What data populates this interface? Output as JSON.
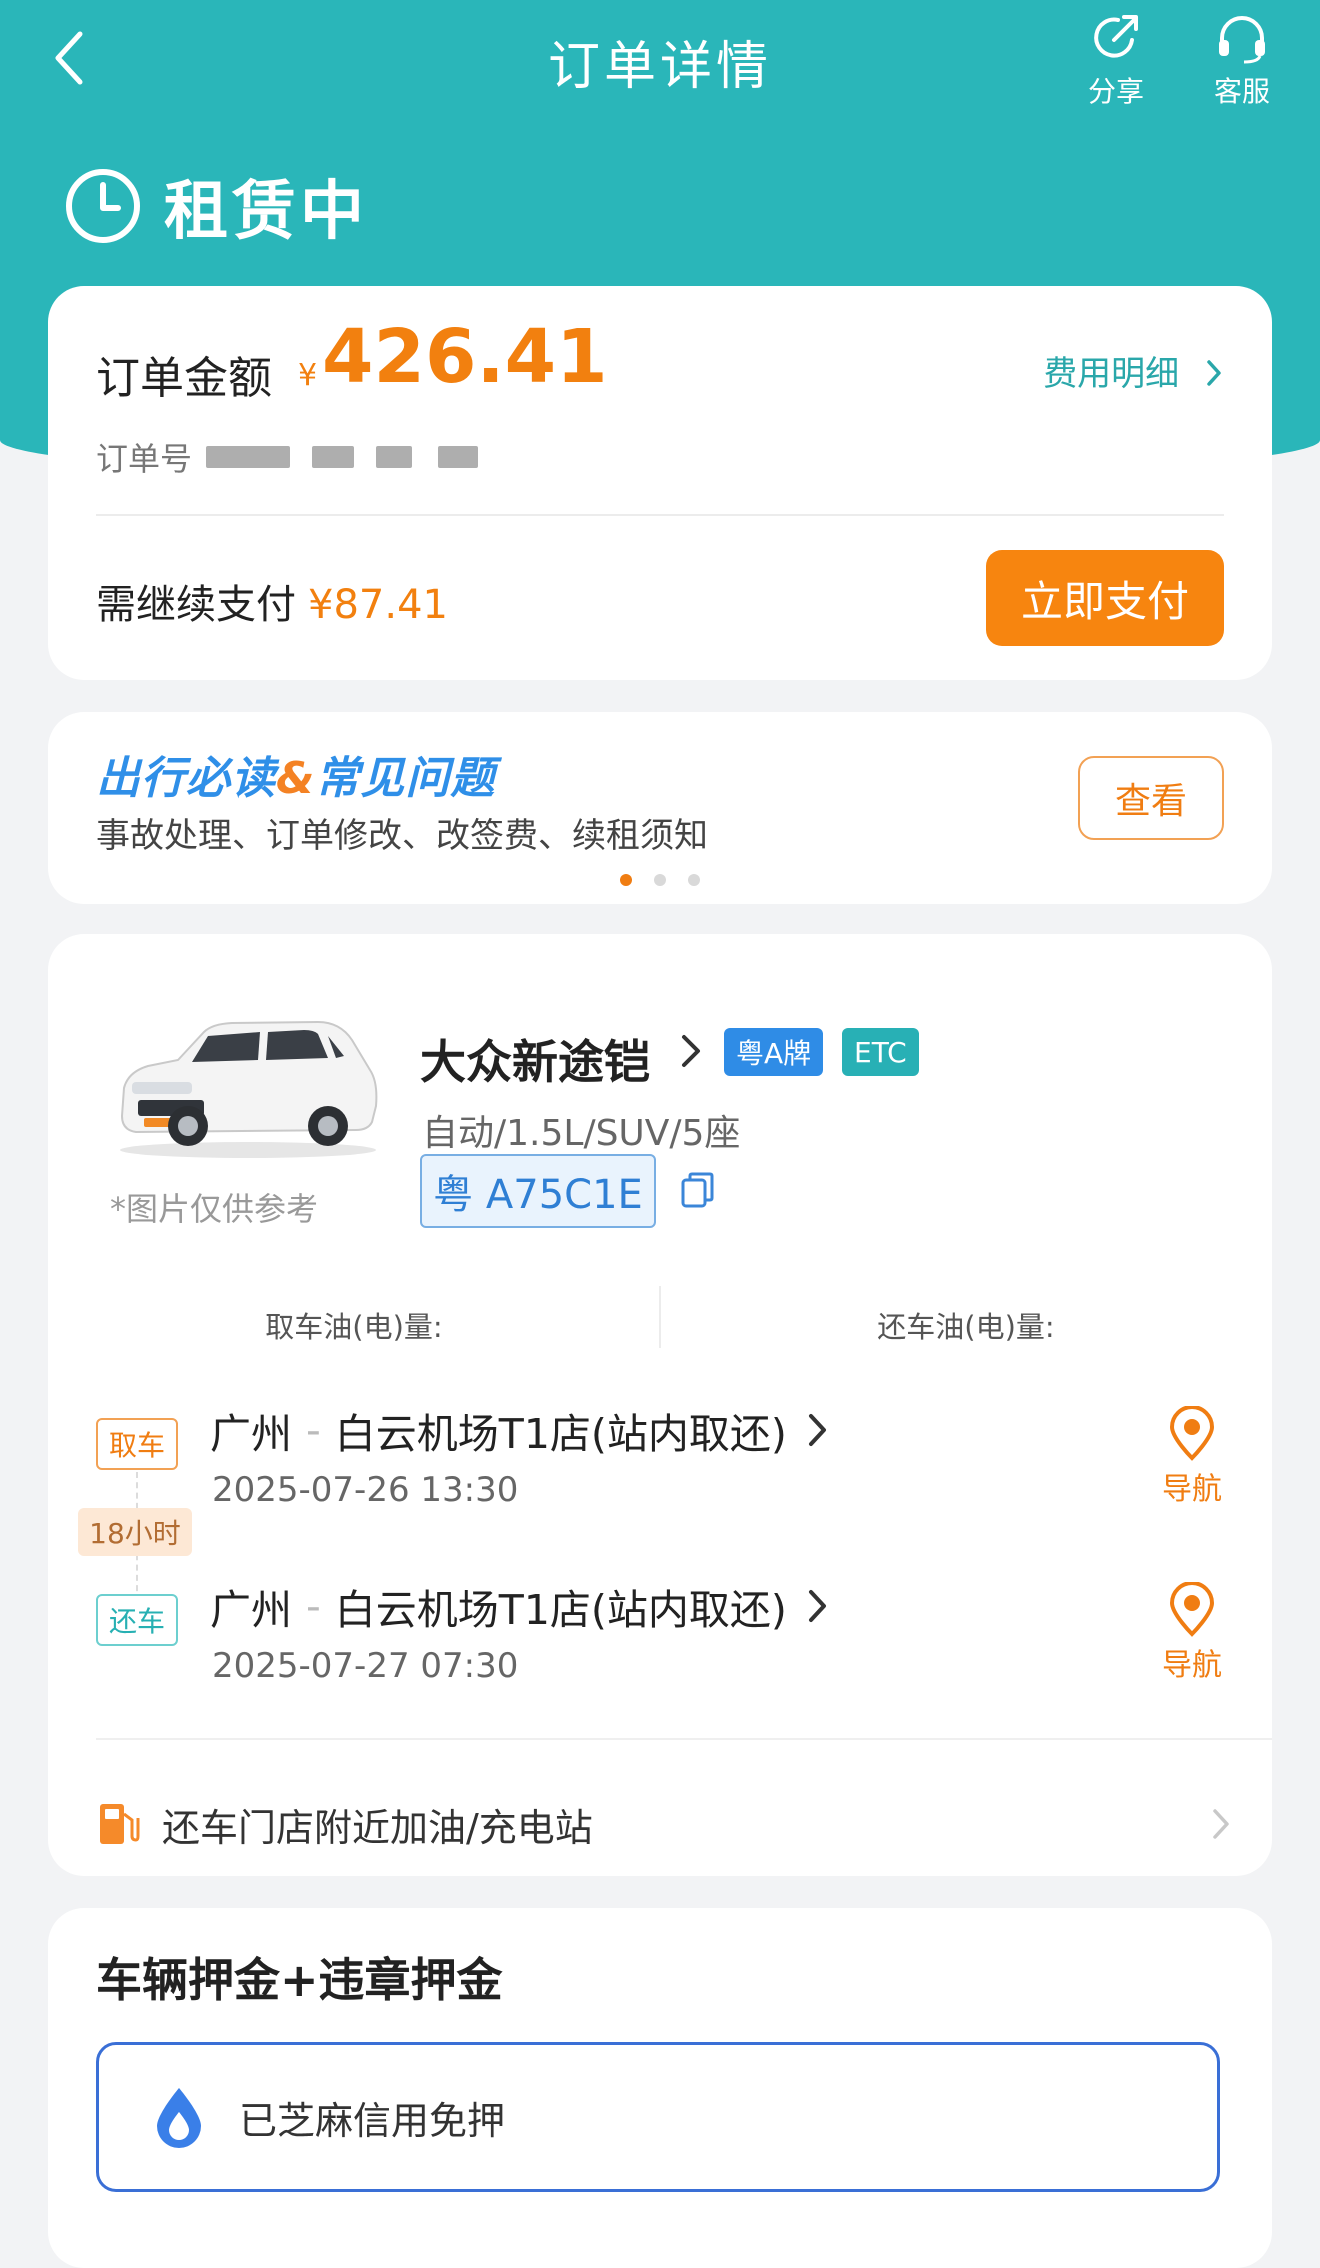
{
  "header": {
    "title": "订单详情",
    "share_label": "分享",
    "service_label": "客服",
    "status": "租赁中"
  },
  "order": {
    "amount_label": "订单金额",
    "currency": "¥",
    "amount": "426.41",
    "fee_detail_link": "费用明细",
    "order_no_label": "订单号",
    "need_pay_label": "需继续支付",
    "need_pay_amount": "¥87.41",
    "pay_button": "立即支付"
  },
  "faq": {
    "title_part1": "出行必读",
    "title_amp": "&",
    "title_part2": "常见问题",
    "subtitle": "事故处理、订单修改、改签费、续租须知",
    "view_button": "查看",
    "pages": 3,
    "active_page": 1
  },
  "car": {
    "name": "大众新途铠",
    "tag_plate": "粤A牌",
    "tag_etc": "ETC",
    "spec": "自动/1.5L/SUV/5座",
    "plate": "粤 A75C1E",
    "image_note": "*图片仅供参考",
    "pickup_fuel_label": "取车油(电)量:",
    "return_fuel_label": "还车油(电)量:"
  },
  "trip": {
    "pickup_badge": "取车",
    "return_badge": "还车",
    "duration": "18小时",
    "pickup_city": "广州",
    "pickup_store": "白云机场T1店(站内取还)",
    "pickup_time": "2025-07-26 13:30",
    "return_city": "广州",
    "return_store": "白云机场T1店(站内取还)",
    "return_time": "2025-07-27 07:30",
    "nav_label": "导航",
    "separator": "-"
  },
  "gas": {
    "label": "还车门店附近加油/充电站"
  },
  "deposit": {
    "title": "车辆押金+违章押金",
    "credit_text": "已芝麻信用免押"
  },
  "colors": {
    "brand_teal": "#2ab6b9",
    "accent_orange": "#f7850f",
    "link_teal": "#2aa7aa",
    "faq_blue": "#2f8fe8"
  }
}
